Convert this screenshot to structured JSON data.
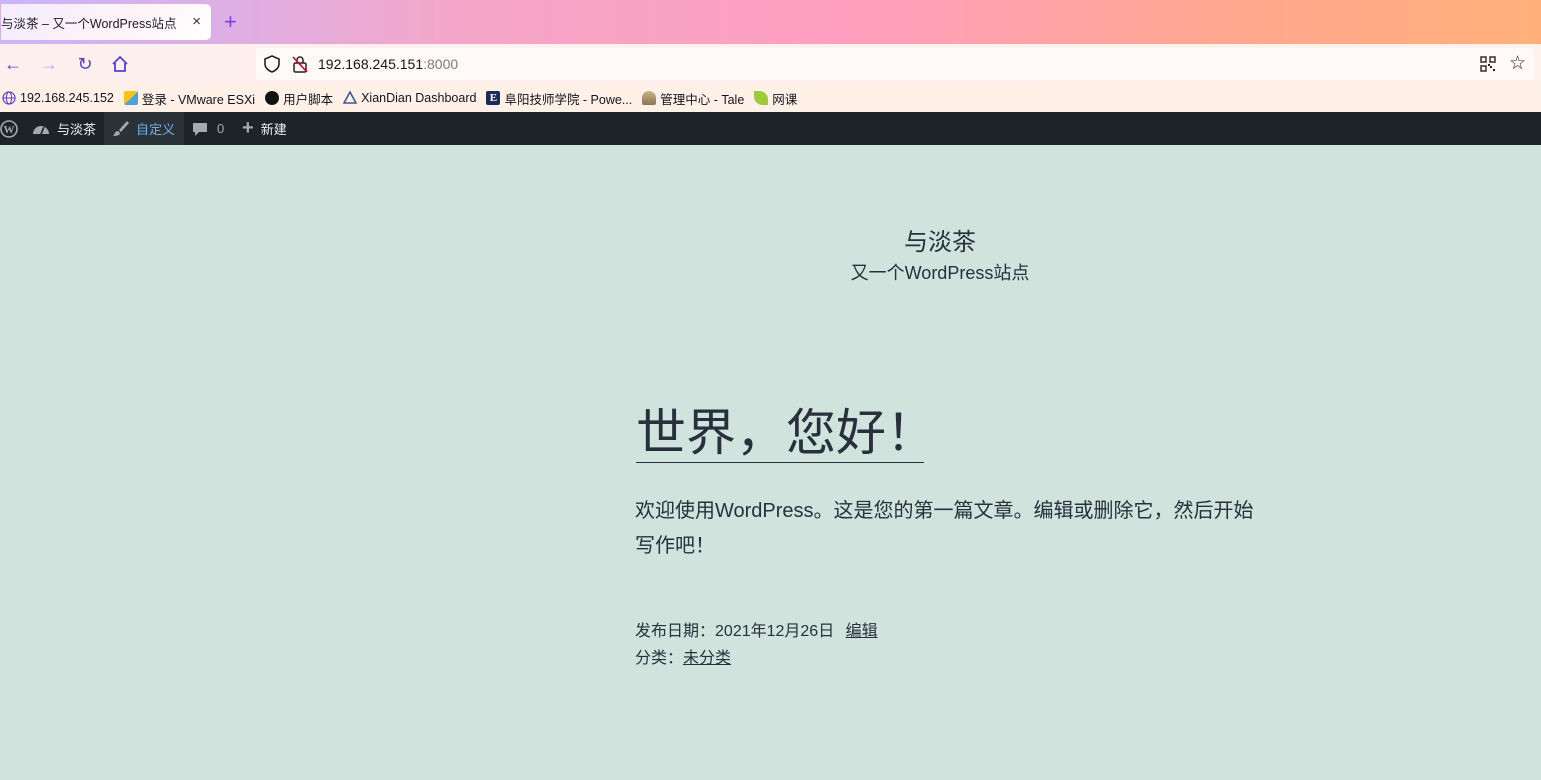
{
  "browser": {
    "tab": {
      "title": "与淡茶 – 又一个WordPress站点",
      "close": "×"
    },
    "new_tab": "+",
    "url": {
      "host": "192.168.245.151",
      "port": ":8000"
    },
    "bookmarks": [
      {
        "label": "192.168.245.152",
        "icon": "globe-icon"
      },
      {
        "label": "登录 - VMware ESXi",
        "icon": "vmware-icon"
      },
      {
        "label": "用户脚本",
        "icon": "userscript-icon"
      },
      {
        "label": "XianDian Dashboard",
        "icon": "openstack-icon"
      },
      {
        "label": "阜阳技师学院 - Powe...",
        "icon": "e-icon"
      },
      {
        "label": "管理中心 - Tale",
        "icon": "tale-icon"
      },
      {
        "label": "网课",
        "icon": "leaf-icon"
      }
    ]
  },
  "adminbar": {
    "site_name": "与淡茶",
    "customize": "自定义",
    "comments_count": "0",
    "new": "新建"
  },
  "site": {
    "title": "与淡茶",
    "description": "又一个WordPress站点"
  },
  "post": {
    "title": "世界，您好！",
    "body": "欢迎使用WordPress。这是您的第一篇文章。编辑或删除它，然后开始写作吧！",
    "date_label": "发布日期：",
    "date": "2021年12月26日",
    "edit": "编辑",
    "category_label": "分类：",
    "category": "未分类"
  }
}
